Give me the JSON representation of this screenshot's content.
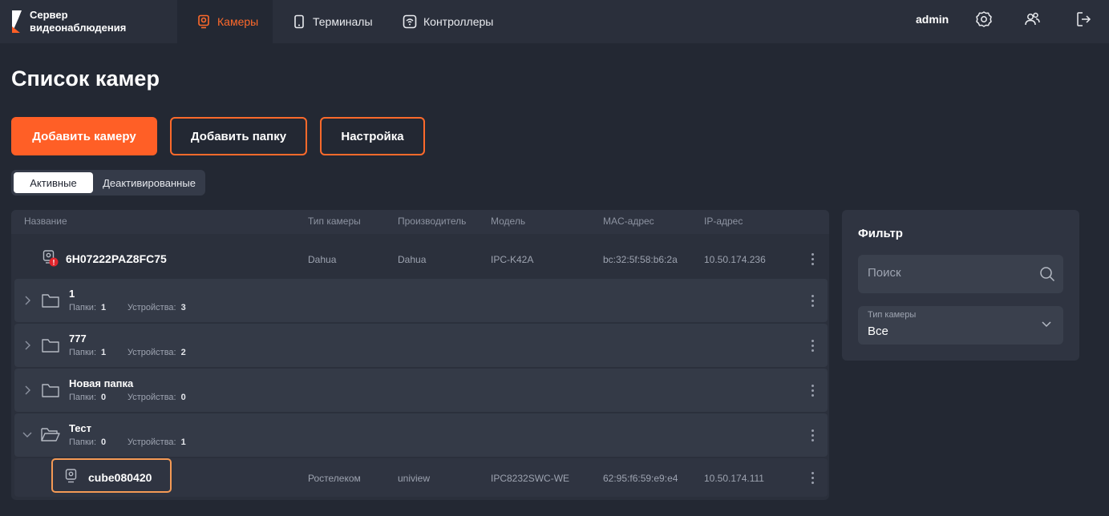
{
  "app": {
    "name_line1": "Сервер",
    "name_line2": "видеонаблюдения"
  },
  "nav": {
    "cameras": "Камеры",
    "terminals": "Терминалы",
    "controllers": "Контроллеры",
    "user": "admin"
  },
  "page": {
    "title": "Список камер"
  },
  "actions": {
    "add_camera": "Добавить камеру",
    "add_folder": "Добавить папку",
    "settings": "Настройка"
  },
  "tabs": {
    "active": "Активные",
    "deactivated": "Деактивированные"
  },
  "table": {
    "headers": {
      "name": "Название",
      "type": "Тип камеры",
      "vendor": "Производитель",
      "model": "Модель",
      "mac": "MAC-адрес",
      "ip": "IP-адрес"
    },
    "camera1": {
      "name": "6H07222PAZ8FC75",
      "type": "Dahua",
      "vendor": "Dahua",
      "model": "IPC-K42A",
      "mac": "bc:32:5f:58:b6:2a",
      "ip": "10.50.174.236",
      "badge": "!"
    },
    "folder_labels": {
      "folders": "Папки:",
      "devices": "Устройства:"
    },
    "folders": [
      {
        "name": "1",
        "folders": "1",
        "devices": "3"
      },
      {
        "name": "777",
        "folders": "1",
        "devices": "2"
      },
      {
        "name": "Новая папка",
        "folders": "0",
        "devices": "0"
      },
      {
        "name": "Тест",
        "folders": "0",
        "devices": "1"
      }
    ],
    "camera2": {
      "name": "cube080420",
      "type": "Ростелеком",
      "vendor": "uniview",
      "model": "IPC8232SWC-WE",
      "mac": "62:95:f6:59:e9:e4",
      "ip": "10.50.174.111"
    }
  },
  "filter": {
    "title": "Фильтр",
    "search_placeholder": "Поиск",
    "camera_type_label": "Тип камеры",
    "camera_type_value": "Все"
  },
  "colors": {
    "accent": "#ff5f26",
    "background": "#232833",
    "panel": "#2b303c"
  }
}
